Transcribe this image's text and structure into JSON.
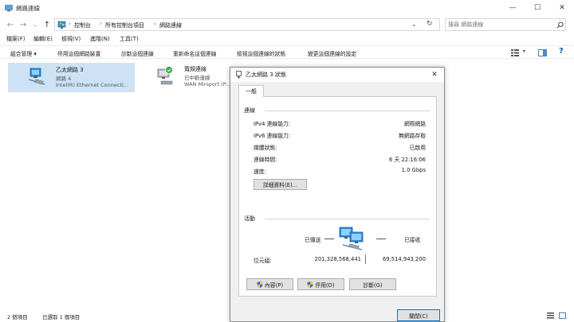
{
  "window": {
    "title": "網路連線"
  },
  "address": {
    "crumbs": [
      "控制台",
      "所有控制台項目",
      "網路連線"
    ],
    "search_placeholder": "搜尋 網路連線"
  },
  "menu": [
    "檔案(F)",
    "編輯(E)",
    "檢視(V)",
    "進階(N)",
    "工具(T)"
  ],
  "commands": [
    "組合管理 ▾",
    "停用這個網路裝置",
    "診斷這個連線",
    "重新命名這個連線",
    "檢視這個連線的狀態",
    "變更這個連線的設定"
  ],
  "items": [
    {
      "name": "乙太網路 3",
      "line1": "網路 4",
      "line2": "Intel(R) Ethernet Connecti..."
    },
    {
      "name": "寬頻連線",
      "line1": "已中斷連線",
      "line2": "WAN Miniport (P..."
    }
  ],
  "status": {
    "count": "2 個項目",
    "selected": "已選取 1 個項目"
  },
  "dialog": {
    "title": "乙太網路 3 狀態",
    "tab": "一般",
    "connection_group": "連線",
    "rows": [
      {
        "label": "IPv4 連線能力:",
        "value": "網際網路"
      },
      {
        "label": "IPv6 連線能力:",
        "value": "無網路存取"
      },
      {
        "label": "媒體狀態:",
        "value": "已啟用"
      },
      {
        "label": "連線時間:",
        "value": "6 天 22:16:06"
      },
      {
        "label": "速度:",
        "value": "1.0 Gbps"
      }
    ],
    "details_button": "詳細資料(E)...",
    "activity_group": "活動",
    "sent_label": "已傳送",
    "received_label": "已接收",
    "bytes_label": "位元組:",
    "bytes_sent": "201,328,568,441",
    "bytes_received": "69,514,943,200",
    "properties_button": "內容(P)",
    "disable_button": "停用(D)",
    "diagnose_button": "診斷(G)",
    "close_button": "關閉(C)"
  },
  "colors": {
    "selection": "#cde3f5",
    "accent": "#0078d7",
    "dialog_bg": "#f0f0f0"
  }
}
